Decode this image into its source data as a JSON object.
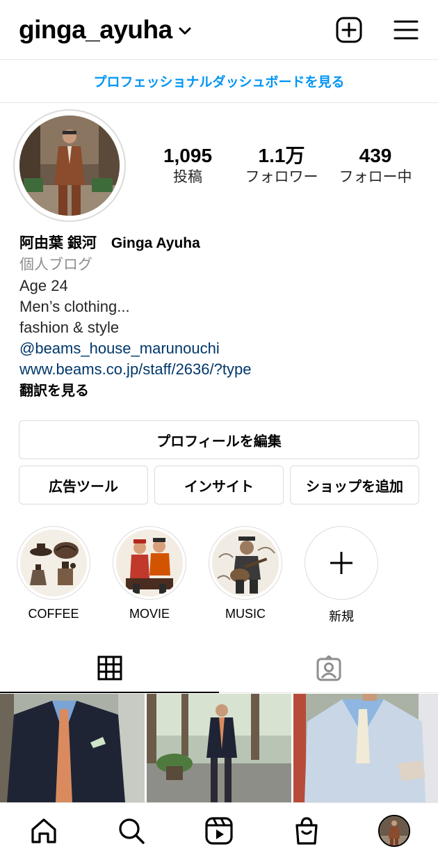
{
  "header": {
    "username": "ginga_ayuha",
    "icons": {
      "dropdown": "chevron-down-icon",
      "add": "plus-square-icon",
      "menu": "hamburger-menu-icon"
    }
  },
  "pro_dashboard": {
    "label": "プロフェッショナルダッシュボードを見る",
    "color": "#0095f6"
  },
  "stats": {
    "posts": {
      "value": "1,095",
      "label": "投稿"
    },
    "followers": {
      "value": "1.1万",
      "label": "フォロワー"
    },
    "following": {
      "value": "439",
      "label": "フォロー中"
    }
  },
  "bio": {
    "name": "阿由葉 銀河　Ginga Ayuha",
    "category": "個人ブログ",
    "lines": [
      "Age 24",
      "Men’s clothing...",
      "fashion & style"
    ],
    "mention": "@beams_house_marunouchi",
    "website": "www.beams.co.jp/staff/2636/?type",
    "translate": "翻訳を見る",
    "link_color": "#00376b"
  },
  "buttons": {
    "edit_profile": "プロフィールを編集",
    "ad_tools": "広告ツール",
    "insights": "インサイト",
    "add_shop": "ショップを追加"
  },
  "highlights": [
    {
      "label": "COFFEE"
    },
    {
      "label": "MOVIE"
    },
    {
      "label": "MUSIC"
    },
    {
      "label": "新規"
    }
  ],
  "tabs": {
    "grid": "grid-icon",
    "tagged": "tagged-person-icon",
    "active": "grid"
  },
  "bottom_nav": [
    "home-icon",
    "search-icon",
    "reels-icon",
    "shop-icon",
    "profile-avatar"
  ]
}
